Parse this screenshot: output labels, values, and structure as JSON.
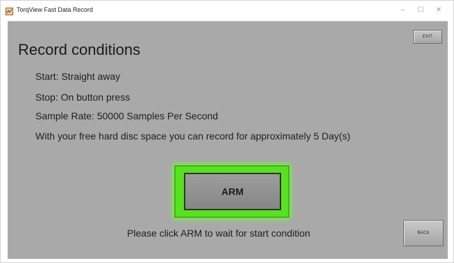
{
  "window": {
    "title": "TorqView Fast Data Record",
    "controls": {
      "minimize": "–",
      "maximize": "☐",
      "close": "✕"
    }
  },
  "main": {
    "heading": "Record conditions",
    "start": "Start: Straight away",
    "stop": "Stop: On button press",
    "sample_rate": "Sample Rate: 50000 Samples Per Second",
    "disk_space": "With your free hard disc space you can record for approximately 5 Day(s)",
    "arm_label": "ARM",
    "status": "Please click ARM to wait for start condition",
    "exit_label": "EXIT",
    "back_label": "BACK"
  },
  "colors": {
    "panel": "#a9a9a9",
    "arm_glow": "#57e21f"
  }
}
